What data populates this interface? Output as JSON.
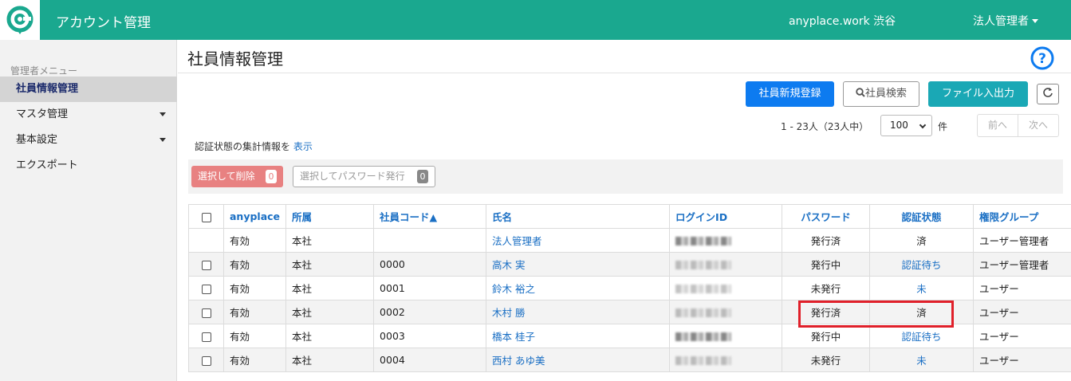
{
  "app": {
    "title": "アカウント管理",
    "site_name": "anyplace.work 渋谷",
    "user_menu": "法人管理者"
  },
  "sidebar": {
    "heading": "管理者メニュー",
    "items": [
      {
        "label": "社員情報管理",
        "active": true,
        "has_caret": false
      },
      {
        "label": "マスタ管理",
        "active": false,
        "has_caret": true
      },
      {
        "label": "基本設定",
        "active": false,
        "has_caret": true
      },
      {
        "label": "エクスポート",
        "active": false,
        "has_caret": false
      }
    ]
  },
  "page": {
    "title": "社員情報管理"
  },
  "toolbar": {
    "new_employee": "社員新規登録",
    "search_employee": "社員検索",
    "file_io": "ファイル入出力"
  },
  "pagination": {
    "count_text": "1 - 23人（23人中）",
    "per_page": "100",
    "unit": "件",
    "prev": "前へ",
    "next": "次へ"
  },
  "auth_summary": {
    "text": "認証状態の集計情報を ",
    "link": "表示"
  },
  "actions": {
    "delete_label": "選択して削除",
    "delete_count": "0",
    "pwissue_label": "選択してパスワード発行",
    "pwissue_count": "0"
  },
  "table": {
    "headers": [
      "anyplace",
      "所属",
      "社員コード▲",
      "氏名",
      "ログインID",
      "パスワード",
      "認証状態",
      "権限グループ"
    ],
    "rows": [
      {
        "has_checkbox": false,
        "anyplace": "有効",
        "dept": "本社",
        "code": "",
        "name": "法人管理者",
        "password": "発行済",
        "auth": "済",
        "auth_link": false,
        "group": "ユーザー管理者"
      },
      {
        "has_checkbox": true,
        "anyplace": "有効",
        "dept": "本社",
        "code": "0000",
        "name": "高木 実",
        "password": "発行中",
        "auth": "認証待ち",
        "auth_link": true,
        "group": "ユーザー管理者"
      },
      {
        "has_checkbox": true,
        "anyplace": "有効",
        "dept": "本社",
        "code": "0001",
        "name": "鈴木 裕之",
        "password": "未発行",
        "auth": "未",
        "auth_link": true,
        "group": "ユーザー"
      },
      {
        "has_checkbox": true,
        "anyplace": "有効",
        "dept": "本社",
        "code": "0002",
        "name": "木村 勝",
        "password": "発行済",
        "auth": "済",
        "auth_link": false,
        "group": "ユーザー"
      },
      {
        "has_checkbox": true,
        "anyplace": "有効",
        "dept": "本社",
        "code": "0003",
        "name": "橋本 桂子",
        "password": "発行中",
        "auth": "認証待ち",
        "auth_link": true,
        "group": "ユーザー"
      },
      {
        "has_checkbox": true,
        "anyplace": "有効",
        "dept": "本社",
        "code": "0004",
        "name": "西村 あゆ美",
        "password": "未発行",
        "auth": "未",
        "auth_link": true,
        "group": "ユーザー"
      }
    ]
  },
  "colors": {
    "brand": "#1aa88f",
    "primary": "#0d7bf0",
    "teal": "#1aa8b5",
    "danger": "#e88181",
    "link": "#1a6fc4",
    "highlight": "#e0202a"
  }
}
